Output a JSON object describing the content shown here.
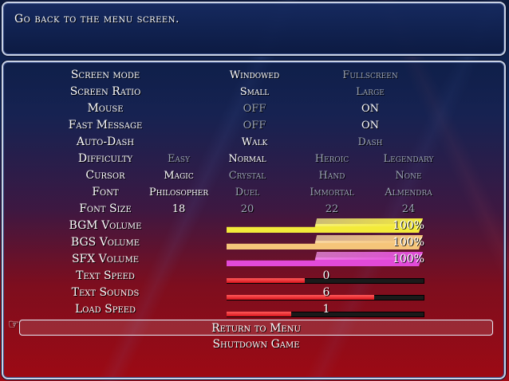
{
  "help": {
    "text": "Go back to the menu screen."
  },
  "colors": {
    "bgm": "#f3ea3a",
    "bgs": "#f5c57a",
    "sfx": "#e24ad8",
    "speed": "#d8141c",
    "text_on": "#ffffff",
    "text_off": "#9aa3b2"
  },
  "options": [
    {
      "label": "Screen mode",
      "choices": [
        "Windowed",
        "Fullscreen"
      ],
      "selected": 0
    },
    {
      "label": "Screen Ratio",
      "choices": [
        "Small",
        "Large"
      ],
      "selected": 0
    },
    {
      "label": "Mouse",
      "choices": [
        "OFF",
        "ON"
      ],
      "selected": 1
    },
    {
      "label": "Fast Message",
      "choices": [
        "OFF",
        "ON"
      ],
      "selected": 1
    },
    {
      "label": "Auto-Dash",
      "choices": [
        "Walk",
        "Dash"
      ],
      "selected": 0
    },
    {
      "label": "Difficulty",
      "choices": [
        "Easy",
        "Normal",
        "Heroic",
        "Legendary"
      ],
      "selected": 1
    },
    {
      "label": "Cursor",
      "choices": [
        "Magic",
        "Crystal",
        "Hand",
        "None"
      ],
      "selected": 0
    },
    {
      "label": "Font",
      "choices": [
        "Philosopher",
        "Duel",
        "Immortal",
        "Almendra"
      ],
      "selected": 0
    },
    {
      "label": "Font Size",
      "choices": [
        "18",
        "20",
        "22",
        "24"
      ],
      "selected": 0
    }
  ],
  "gauges": [
    {
      "label": "BGM Volume",
      "value_text": "100%",
      "fraction": 1.0,
      "kind": "volume",
      "color_key": "bgm"
    },
    {
      "label": "BGS Volume",
      "value_text": "100%",
      "fraction": 1.0,
      "kind": "volume",
      "color_key": "bgs"
    },
    {
      "label": "SFX Volume",
      "value_text": "100%",
      "fraction": 1.0,
      "kind": "volume",
      "color_key": "sfx"
    },
    {
      "label": "Text Speed",
      "value_text": "0",
      "fraction": 0.4,
      "kind": "speed",
      "color_key": "speed"
    },
    {
      "label": "Text Sounds",
      "value_text": "6",
      "fraction": 0.75,
      "kind": "speed",
      "color_key": "speed"
    },
    {
      "label": "Load Speed",
      "value_text": "1",
      "fraction": 0.33,
      "kind": "speed",
      "color_key": "speed"
    }
  ],
  "commands": [
    {
      "label": "Return to Menu",
      "selected": true
    },
    {
      "label": "Shutdown Game",
      "selected": false
    }
  ]
}
